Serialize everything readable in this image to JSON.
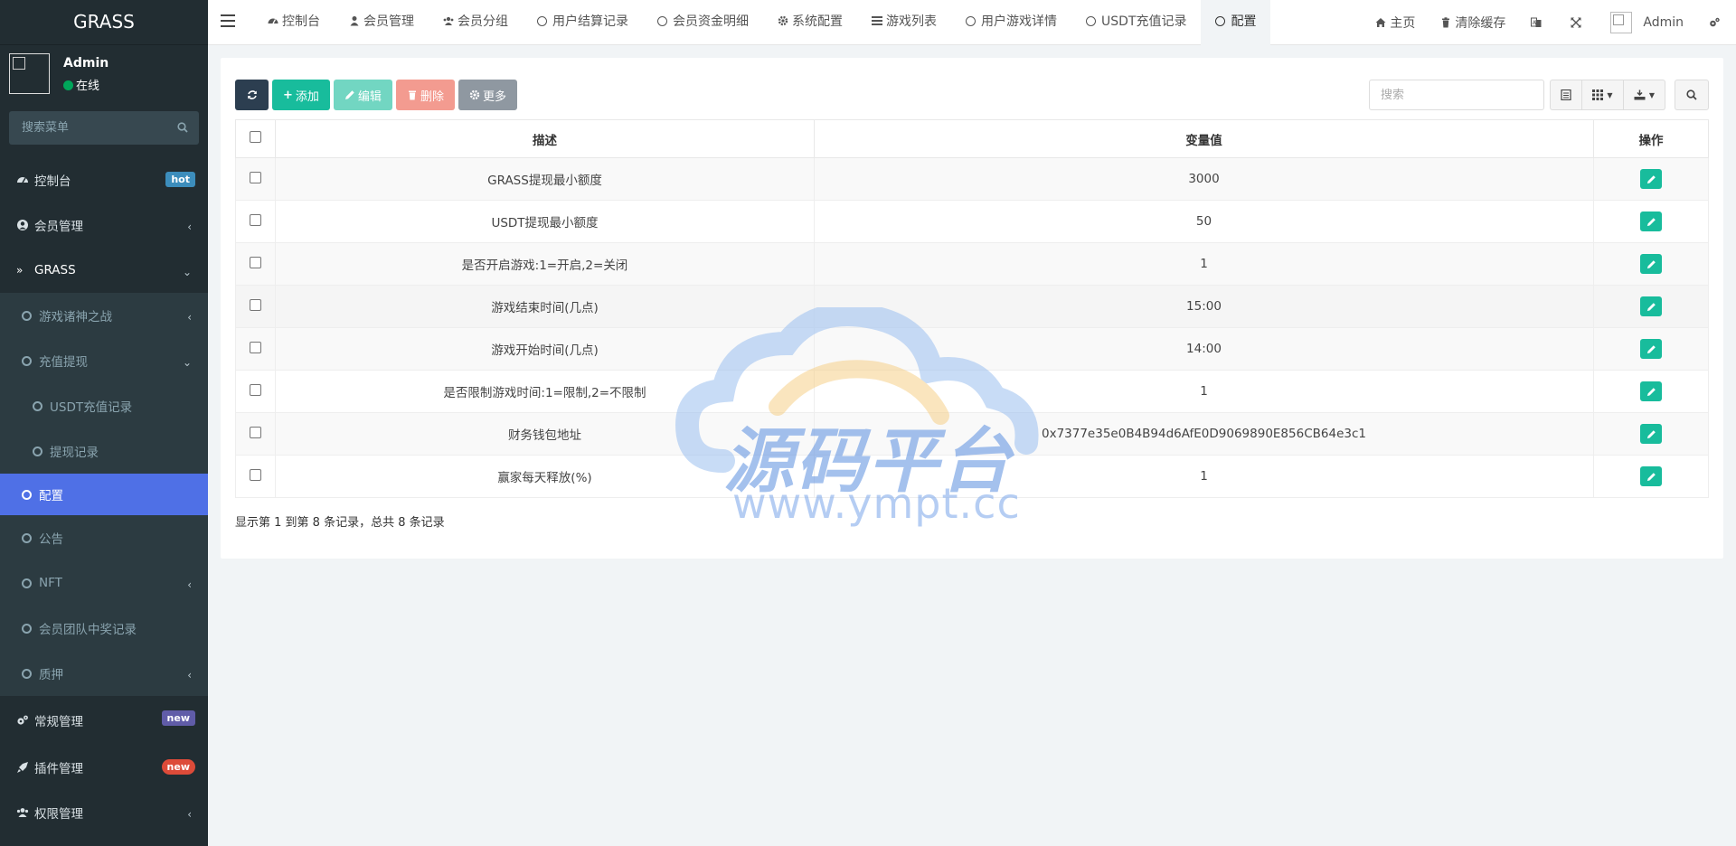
{
  "brand": "GRASS",
  "user": {
    "name": "Admin",
    "status": "在线"
  },
  "sidebar_search": {
    "placeholder": "搜索菜单"
  },
  "menu": {
    "dashboard": {
      "label": "控制台",
      "badge": "hot"
    },
    "member": {
      "label": "会员管理"
    },
    "grass": {
      "label": "GRASS"
    },
    "game_war": {
      "label": "游戏诸神之战"
    },
    "recharge": {
      "label": "充值提现"
    },
    "usdt_recharge": {
      "label": "USDT充值记录"
    },
    "withdraw": {
      "label": "提现记录"
    },
    "config": {
      "label": "配置"
    },
    "notice": {
      "label": "公告"
    },
    "nft": {
      "label": "NFT"
    },
    "team_reward": {
      "label": "会员团队中奖记录"
    },
    "pledge": {
      "label": "质押"
    },
    "general": {
      "label": "常规管理",
      "badge": "new"
    },
    "plugin": {
      "label": "插件管理",
      "badge": "new"
    },
    "auth": {
      "label": "权限管理"
    }
  },
  "tabs": [
    {
      "label": "控制台",
      "icon": "dashboard-icon"
    },
    {
      "label": "会员管理",
      "icon": "user-icon"
    },
    {
      "label": "会员分组",
      "icon": "users-icon"
    },
    {
      "label": "用户结算记录",
      "icon": "circle-icon"
    },
    {
      "label": "会员资金明细",
      "icon": "circle-icon"
    },
    {
      "label": "系统配置",
      "icon": "gear-icon"
    },
    {
      "label": "游戏列表",
      "icon": "list-icon"
    },
    {
      "label": "用户游戏详情",
      "icon": "circle-icon"
    },
    {
      "label": "USDT充值记录",
      "icon": "circle-icon"
    },
    {
      "label": "配置",
      "icon": "circle-icon"
    }
  ],
  "navright": {
    "home": "主页",
    "clear_cache": "清除缓存",
    "admin": "Admin"
  },
  "toolbar": {
    "add": "添加",
    "edit": "编辑",
    "delete": "删除",
    "more": "更多",
    "search_placeholder": "搜索"
  },
  "table": {
    "headers": {
      "desc": "描述",
      "value": "变量值",
      "op": "操作"
    },
    "rows": [
      {
        "desc": "GRASS提现最小额度",
        "value": "3000"
      },
      {
        "desc": "USDT提现最小额度",
        "value": "50"
      },
      {
        "desc": "是否开启游戏:1=开启,2=关闭",
        "value": "1"
      },
      {
        "desc": "游戏结束时间(几点)",
        "value": "15:00"
      },
      {
        "desc": "游戏开始时间(几点)",
        "value": "14:00"
      },
      {
        "desc": "是否限制游戏时间:1=限制,2=不限制",
        "value": "1"
      },
      {
        "desc": "财务钱包地址",
        "value": "0x7377e35e0B4B94d6AfE0D9069890E856CB64e3c1"
      },
      {
        "desc": "赢家每天释放(%)",
        "value": "1"
      }
    ]
  },
  "footer_text": "显示第 1 到第 8 条记录，总共 8 条记录",
  "watermark": {
    "text": "源码平台",
    "url": "www.ympt.cc"
  },
  "colors": {
    "sidebar": "#222d32",
    "active": "#4f70e6",
    "success": "#18bc9c",
    "primary": "#2c3e50"
  }
}
